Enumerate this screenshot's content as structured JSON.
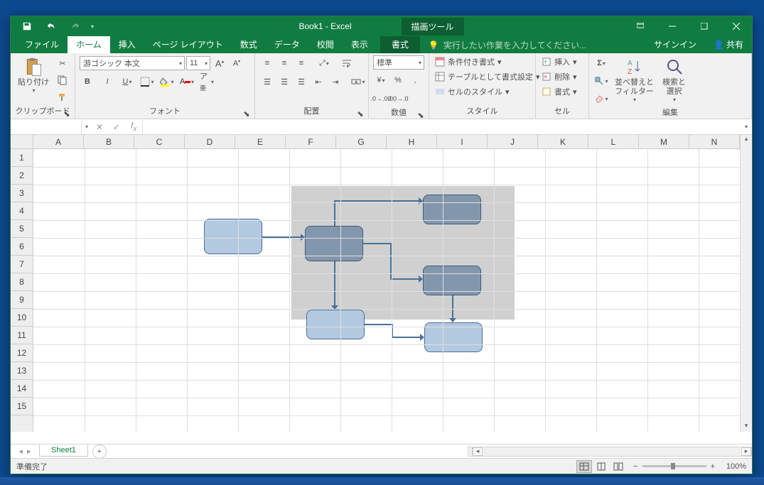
{
  "titlebar": {
    "title": "Book1 - Excel",
    "context_tool": "描画ツール"
  },
  "tabs": {
    "file": "ファイル",
    "home": "ホーム",
    "insert": "挿入",
    "pagelayout": "ページ レイアウト",
    "formulas": "数式",
    "data": "データ",
    "review": "校閲",
    "view": "表示",
    "format": "書式",
    "signin": "サインイン",
    "share": "共有"
  },
  "tellme": "実行したい作業を入力してください...",
  "ribbon": {
    "clipboard": {
      "label": "クリップボード",
      "paste": "貼り付け"
    },
    "font": {
      "label": "フォント",
      "name": "游ゴシック 本文",
      "size": "11"
    },
    "alignment": {
      "label": "配置"
    },
    "number": {
      "label": "数値",
      "format": "標準"
    },
    "styles": {
      "label": "スタイル",
      "conditional": "条件付き書式",
      "table": "テーブルとして書式設定",
      "cell": "セルのスタイル"
    },
    "cells": {
      "label": "セル",
      "insert": "挿入",
      "delete": "削除",
      "format": "書式"
    },
    "editing": {
      "label": "編集",
      "sort": "並べ替えと\nフィルター",
      "find": "検索と\n選択"
    }
  },
  "columns": [
    "A",
    "B",
    "C",
    "D",
    "E",
    "F",
    "G",
    "H",
    "I",
    "J",
    "K",
    "L",
    "M",
    "N"
  ],
  "rows": [
    "1",
    "2",
    "3",
    "4",
    "5",
    "6",
    "7",
    "8",
    "9",
    "10",
    "11",
    "12",
    "13",
    "14",
    "15"
  ],
  "sheet": {
    "tab": "Sheet1"
  },
  "status": {
    "ready": "準備完了",
    "zoom": "100%"
  }
}
